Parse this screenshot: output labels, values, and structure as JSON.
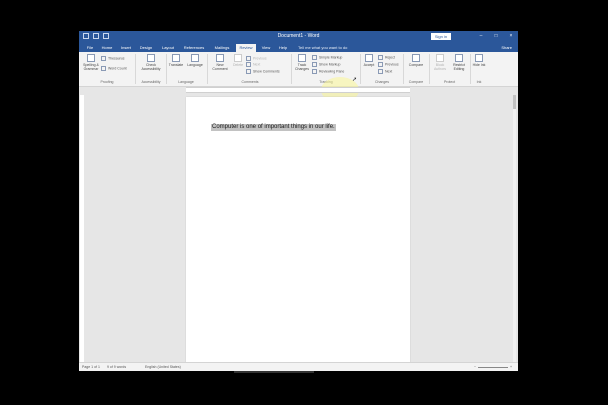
{
  "window": {
    "title": "Document1 - Word",
    "sign_in": "Sign in",
    "share": "Share",
    "tell_me": "Tell me what you want to do"
  },
  "tabs": [
    "File",
    "Home",
    "Insert",
    "Design",
    "Layout",
    "References",
    "Mailings",
    "Review",
    "View",
    "Help"
  ],
  "active_tab": "Review",
  "ribbon": {
    "spelling": "Spelling & Grammar",
    "thesaurus": "Thesaurus",
    "word_count": "Word Count",
    "proofing": "Proofing",
    "check_accessibility": "Check Accessibility",
    "accessibility": "Accessibility",
    "translate": "Translate",
    "language_btn": "Language",
    "language": "Language",
    "new_comment": "New Comment",
    "delete": "Delete",
    "previous": "Previous",
    "next": "Next",
    "show_comments": "Show Comments",
    "comments": "Comments",
    "track_changes": "Track Changes",
    "simple_markup": "Simple Markup",
    "show_markup": "Show Markup",
    "reviewing_pane": "Reviewing Pane",
    "tracking": "Tracking",
    "accept": "Accept",
    "reject": "Reject",
    "changes_previous": "Previous",
    "changes_next": "Next",
    "changes": "Changes",
    "compare_btn": "Compare",
    "compare": "Compare",
    "block_authors": "Block Authors",
    "restrict_editing": "Restrict Editing",
    "protect": "Protect",
    "hide_ink": "Hide Ink",
    "ink": "Ink"
  },
  "document": {
    "text": "Computer is one of important things in our life."
  },
  "status": {
    "page": "Page 1 of 1",
    "words": "9 of 9 words",
    "language": "English (United States)"
  },
  "colors": {
    "title_bar": "#2b579a",
    "ribbon": "#f3f3f3",
    "highlight": "#c2c2c2"
  }
}
